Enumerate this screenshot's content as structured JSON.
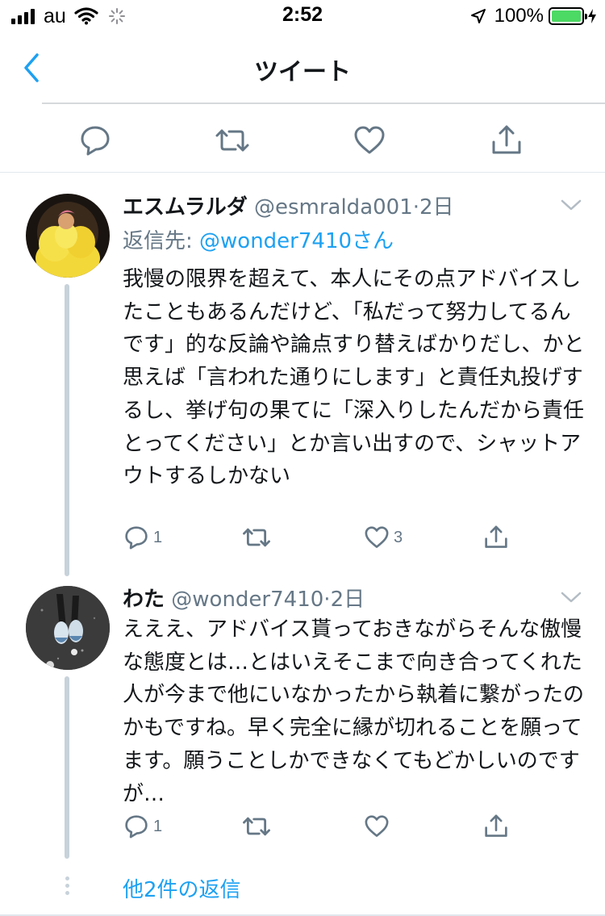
{
  "status_bar": {
    "carrier": "au",
    "time": "2:52",
    "battery_percent": "100%",
    "battery_level": 1.0,
    "battery_color": "#4cd964"
  },
  "nav": {
    "title": "ツイート",
    "back_icon": "chevron-left-icon"
  },
  "top_actions": [
    "reply-icon",
    "retweet-icon",
    "like-icon",
    "share-icon"
  ],
  "tweets": [
    {
      "name": "エスムラルダ",
      "handle": "@esmralda001",
      "separator": "·",
      "time": "2日",
      "reply_prefix": "返信先: ",
      "reply_to": "@wonder7410さん",
      "text": "我慢の限界を超えて、本人にその点アドバイスしたこともあるんだけど、「私だって努力してるんです」的な反論や論点すり替えばかりだし、かと思えば「言われた通りにします」と責任丸投げするし、挙げ句の果てに「深入りしたんだから責任とってください」とか言い出すので、シャットアウトするしかない",
      "reply_count": "1",
      "retweet_count": "",
      "like_count": "3"
    },
    {
      "name": "わた",
      "handle": "@wonder7410",
      "separator": "·",
      "time": "2日",
      "text": "えええ、アドバイス貰っておきながらそんな傲慢な態度とは…とはいえそこまで向き合ってくれた人が今まで他にいなかったから執着に繋がったのかもですね。早く完全に縁が切れることを願ってます。願うことしかできなくてもどかしいのですが…",
      "reply_count": "1",
      "retweet_count": "",
      "like_count": ""
    }
  ],
  "more_replies": "他2件の返信",
  "colors": {
    "accent": "#1da1f2",
    "secondary_text": "#657786",
    "icon": "#657786",
    "thread_line": "#c7d2da"
  }
}
